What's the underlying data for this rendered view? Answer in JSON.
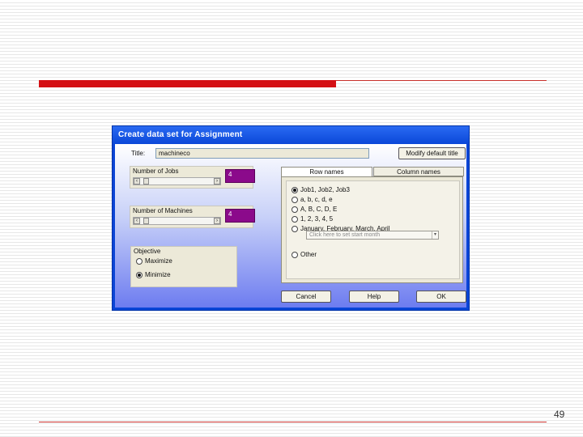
{
  "slide": {
    "page_number": "49"
  },
  "dialog": {
    "title": "Create data set for Assignment",
    "title_label": "Title:",
    "title_value": "machineco",
    "modify_button": "Modify default title",
    "jobs_label": "Number of Jobs",
    "jobs_value": "4",
    "machines_label": "Number of Machines",
    "machines_value": "4",
    "objective": {
      "label": "Objective",
      "options": [
        {
          "label": "Maximize",
          "selected": false
        },
        {
          "label": "Minimize",
          "selected": true
        }
      ]
    },
    "tabs": [
      {
        "label": "Row names",
        "active": true
      },
      {
        "label": "Column names",
        "active": false
      }
    ],
    "row_name_options": [
      {
        "label": "Job1, Job2, Job3",
        "selected": true
      },
      {
        "label": "a, b, c, d, e",
        "selected": false
      },
      {
        "label": "A, B, C, D, E",
        "selected": false
      },
      {
        "label": "1, 2, 3, 4, 5",
        "selected": false
      },
      {
        "label": "January, February, March, April",
        "selected": false
      }
    ],
    "month_dropdown_placeholder": "Click here to set start month",
    "other_option": "Other",
    "buttons": {
      "cancel": "Cancel",
      "help": "Help",
      "ok": "OK"
    }
  },
  "colors": {
    "accent_red": "#d40f14",
    "title_bar_blue": "#0a45d6",
    "value_box_purple": "#8b0a8b"
  },
  "icons": [
    "scroll-left-arrow-icon",
    "scroll-right-arrow-icon",
    "dropdown-arrow-icon"
  ]
}
